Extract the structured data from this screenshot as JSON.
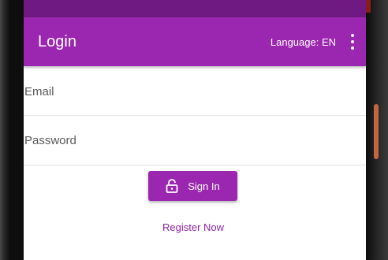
{
  "app_bar": {
    "title": "Login",
    "language_label": "Language: EN",
    "menu_icon": "more-vert-icon"
  },
  "form": {
    "email_placeholder": "Email",
    "password_placeholder": "Password"
  },
  "actions": {
    "signin_label": "Sign In",
    "signin_icon": "lock-open-icon",
    "register_label": "Register Now"
  },
  "colors": {
    "primary": "#9b27b0",
    "primary_dark": "#6f1a83",
    "link": "#8e24aa"
  }
}
